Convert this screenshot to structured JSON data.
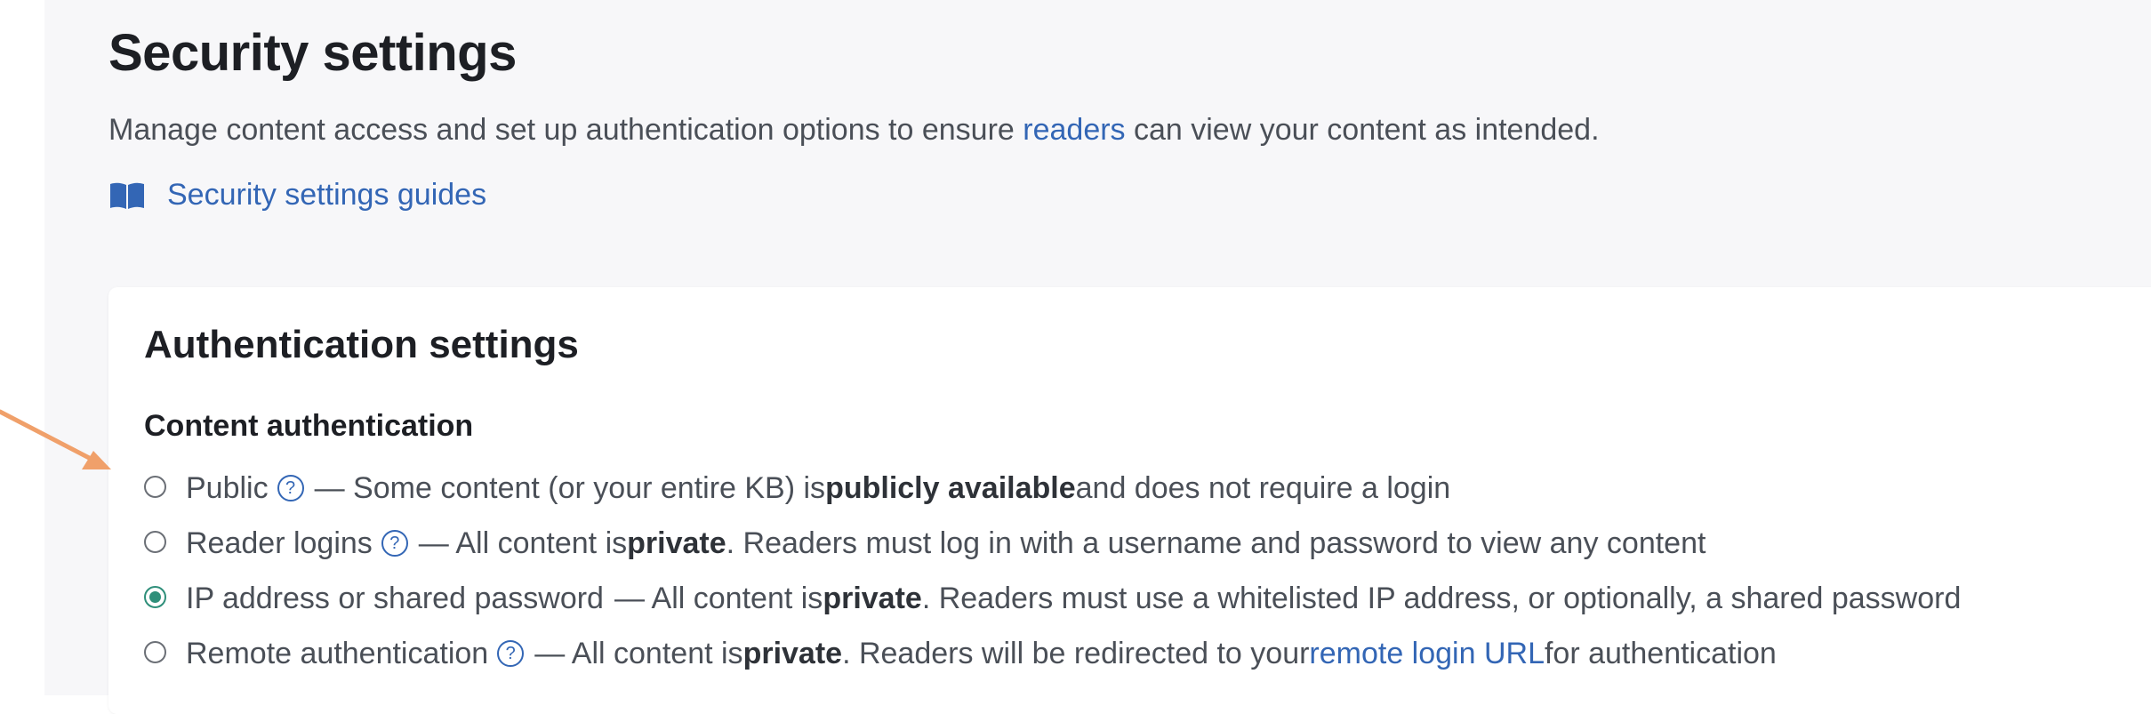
{
  "page": {
    "title": "Security settings",
    "description_before": "Manage content access and set up authentication options to ensure ",
    "description_link": "readers",
    "description_after": " can view your content as intended.",
    "guides_link": "Security settings guides"
  },
  "card": {
    "title": "Authentication settings",
    "section_label": "Content authentication",
    "options": [
      {
        "label": "Public",
        "text_before": "— Some content (or your entire KB) is ",
        "bold": "publicly available",
        "text_after": " and does not require a login",
        "checked": false,
        "help": "?"
      },
      {
        "label": "Reader logins",
        "text_before": "— All content is ",
        "bold": "private",
        "text_after": ". Readers must log in with a username and password to view any content",
        "checked": false,
        "help": "?"
      },
      {
        "label": "IP address or shared password",
        "text_before": "— All content is ",
        "bold": "private",
        "text_after": ". Readers must use a whitelisted IP address, or optionally, a shared password",
        "checked": true
      },
      {
        "label": "Remote authentication",
        "text_before": "— All content is ",
        "bold": "private",
        "text_after": ". Readers will be redirected to your ",
        "link": "remote login URL",
        "text_end": " for authentication",
        "checked": false,
        "help": "?"
      }
    ]
  },
  "colors": {
    "accent": "#3366b5",
    "selected": "#2f8f7a",
    "annotation_arrow": "#f0a06a"
  },
  "icons": {
    "guides": "book-open-icon",
    "help": "question-circle-icon"
  }
}
